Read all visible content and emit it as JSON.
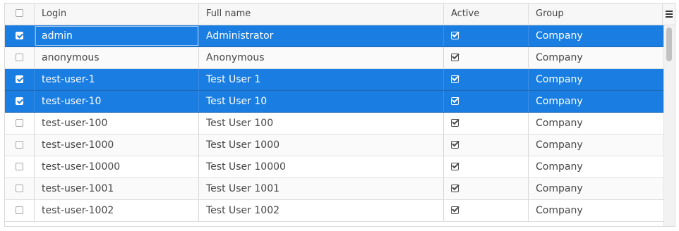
{
  "columns": {
    "select_all_checked": false,
    "login": "Login",
    "full_name": "Full name",
    "active": "Active",
    "group": "Group"
  },
  "rows": [
    {
      "checked": true,
      "login": "admin",
      "full_name": "Administrator",
      "active": true,
      "group": "Company",
      "selected": true
    },
    {
      "checked": false,
      "login": "anonymous",
      "full_name": "Anonymous",
      "active": true,
      "group": "Company",
      "selected": false
    },
    {
      "checked": true,
      "login": "test-user-1",
      "full_name": "Test User 1",
      "active": true,
      "group": "Company",
      "selected": true
    },
    {
      "checked": true,
      "login": "test-user-10",
      "full_name": "Test User 10",
      "active": true,
      "group": "Company",
      "selected": true
    },
    {
      "checked": false,
      "login": "test-user-100",
      "full_name": "Test User 100",
      "active": true,
      "group": "Company",
      "selected": false
    },
    {
      "checked": false,
      "login": "test-user-1000",
      "full_name": "Test User 1000",
      "active": true,
      "group": "Company",
      "selected": false
    },
    {
      "checked": false,
      "login": "test-user-10000",
      "full_name": "Test User 10000",
      "active": true,
      "group": "Company",
      "selected": false
    },
    {
      "checked": false,
      "login": "test-user-1001",
      "full_name": "Test User 1001",
      "active": true,
      "group": "Company",
      "selected": false
    },
    {
      "checked": false,
      "login": "test-user-1002",
      "full_name": "Test User 1002",
      "active": true,
      "group": "Company",
      "selected": false
    }
  ],
  "colors": {
    "selection": "#197de1",
    "header_bg": "#f7f7f7",
    "text": "#474747"
  },
  "icons": {
    "active": "check-square-icon",
    "menu": "hamburger-menu-icon"
  }
}
